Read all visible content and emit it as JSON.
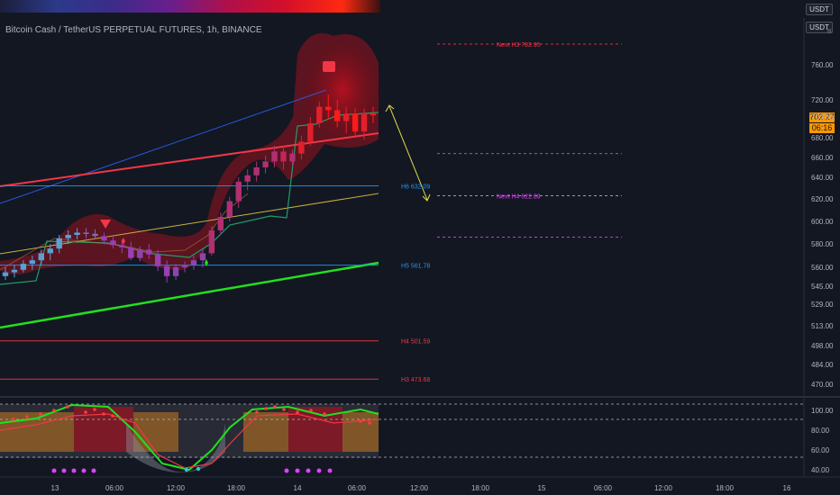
{
  "chart": {
    "title": "Bitcoin Cash / TetherUS PERPETUAL FUTURES, 1h, BINANCE",
    "quote_currency": "USDT",
    "quote_currency_top": "USDT",
    "corner_text": "B",
    "last_price": "702.27",
    "countdown": "06:16"
  },
  "chart_data": {
    "type": "candlestick",
    "price_axis_ticks": [
      760.0,
      720.0,
      700.0,
      680.0,
      660.0,
      640.0,
      620.0,
      600.0,
      580.0,
      560.0,
      545.0,
      529.0,
      513.0,
      498.0,
      484.0,
      470.0
    ],
    "oscillator_axis_ticks": [
      100.0,
      80.0,
      60.0,
      40.0
    ],
    "time_axis_ticks": [
      "13",
      "06:00",
      "12:00",
      "18:00",
      "14",
      "06:00",
      "12:00",
      "18:00",
      "15",
      "06:00",
      "12:00",
      "18:00",
      "16"
    ],
    "levels": [
      {
        "label": "Next H3 782.95",
        "value": 782.95,
        "color": "#f23645"
      },
      {
        "label": "H6 632.09",
        "value": 632.09,
        "color": "#2196f3"
      },
      {
        "label": "Next H4 622.89",
        "value": 622.89,
        "color": "#e040fb"
      },
      {
        "label": "H5 561.78",
        "value": 561.78,
        "color": "#2196f3"
      },
      {
        "label": "H4 501.59",
        "value": 501.59,
        "color": "#f23645"
      },
      {
        "label": "H3 473.68",
        "value": 473.68,
        "color": "#f23645"
      }
    ],
    "future_dashed_levels": [
      782.95,
      664,
      622.89,
      586
    ],
    "candles": [
      {
        "o": 553,
        "h": 560,
        "l": 550,
        "c": 556
      },
      {
        "o": 556,
        "h": 562,
        "l": 552,
        "c": 558
      },
      {
        "o": 558,
        "h": 566,
        "l": 556,
        "c": 563
      },
      {
        "o": 563,
        "h": 570,
        "l": 558,
        "c": 566
      },
      {
        "o": 566,
        "h": 575,
        "l": 562,
        "c": 572
      },
      {
        "o": 572,
        "h": 580,
        "l": 566,
        "c": 576
      },
      {
        "o": 576,
        "h": 588,
        "l": 572,
        "c": 585
      },
      {
        "o": 585,
        "h": 592,
        "l": 580,
        "c": 588
      },
      {
        "o": 588,
        "h": 594,
        "l": 584,
        "c": 590
      },
      {
        "o": 590,
        "h": 594,
        "l": 585,
        "c": 589
      },
      {
        "o": 589,
        "h": 593,
        "l": 584,
        "c": 587
      },
      {
        "o": 587,
        "h": 590,
        "l": 580,
        "c": 583
      },
      {
        "o": 583,
        "h": 588,
        "l": 576,
        "c": 579
      },
      {
        "o": 579,
        "h": 584,
        "l": 572,
        "c": 577
      },
      {
        "o": 577,
        "h": 582,
        "l": 566,
        "c": 568
      },
      {
        "o": 568,
        "h": 578,
        "l": 565,
        "c": 575
      },
      {
        "o": 575,
        "h": 580,
        "l": 567,
        "c": 571
      },
      {
        "o": 571,
        "h": 575,
        "l": 557,
        "c": 561
      },
      {
        "o": 561,
        "h": 566,
        "l": 548,
        "c": 553
      },
      {
        "o": 553,
        "h": 563,
        "l": 550,
        "c": 560
      },
      {
        "o": 560,
        "h": 565,
        "l": 556,
        "c": 562
      },
      {
        "o": 562,
        "h": 570,
        "l": 558,
        "c": 566
      },
      {
        "o": 566,
        "h": 575,
        "l": 560,
        "c": 572
      },
      {
        "o": 572,
        "h": 596,
        "l": 570,
        "c": 592
      },
      {
        "o": 592,
        "h": 608,
        "l": 588,
        "c": 604
      },
      {
        "o": 604,
        "h": 622,
        "l": 600,
        "c": 618
      },
      {
        "o": 618,
        "h": 640,
        "l": 612,
        "c": 636
      },
      {
        "o": 636,
        "h": 648,
        "l": 628,
        "c": 642
      },
      {
        "o": 642,
        "h": 656,
        "l": 636,
        "c": 650
      },
      {
        "o": 650,
        "h": 662,
        "l": 644,
        "c": 656
      },
      {
        "o": 656,
        "h": 672,
        "l": 650,
        "c": 666
      },
      {
        "o": 666,
        "h": 672,
        "l": 648,
        "c": 656
      },
      {
        "o": 656,
        "h": 668,
        "l": 652,
        "c": 664
      },
      {
        "o": 664,
        "h": 682,
        "l": 658,
        "c": 676
      },
      {
        "o": 676,
        "h": 700,
        "l": 672,
        "c": 694
      },
      {
        "o": 694,
        "h": 718,
        "l": 690,
        "c": 712
      },
      {
        "o": 712,
        "h": 726,
        "l": 698,
        "c": 708
      },
      {
        "o": 708,
        "h": 720,
        "l": 690,
        "c": 696
      },
      {
        "o": 696,
        "h": 712,
        "l": 684,
        "c": 704
      },
      {
        "o": 704,
        "h": 710,
        "l": 680,
        "c": 686
      },
      {
        "o": 686,
        "h": 710,
        "l": 678,
        "c": 704
      },
      {
        "o": 704,
        "h": 712,
        "l": 694,
        "c": 702
      }
    ]
  }
}
